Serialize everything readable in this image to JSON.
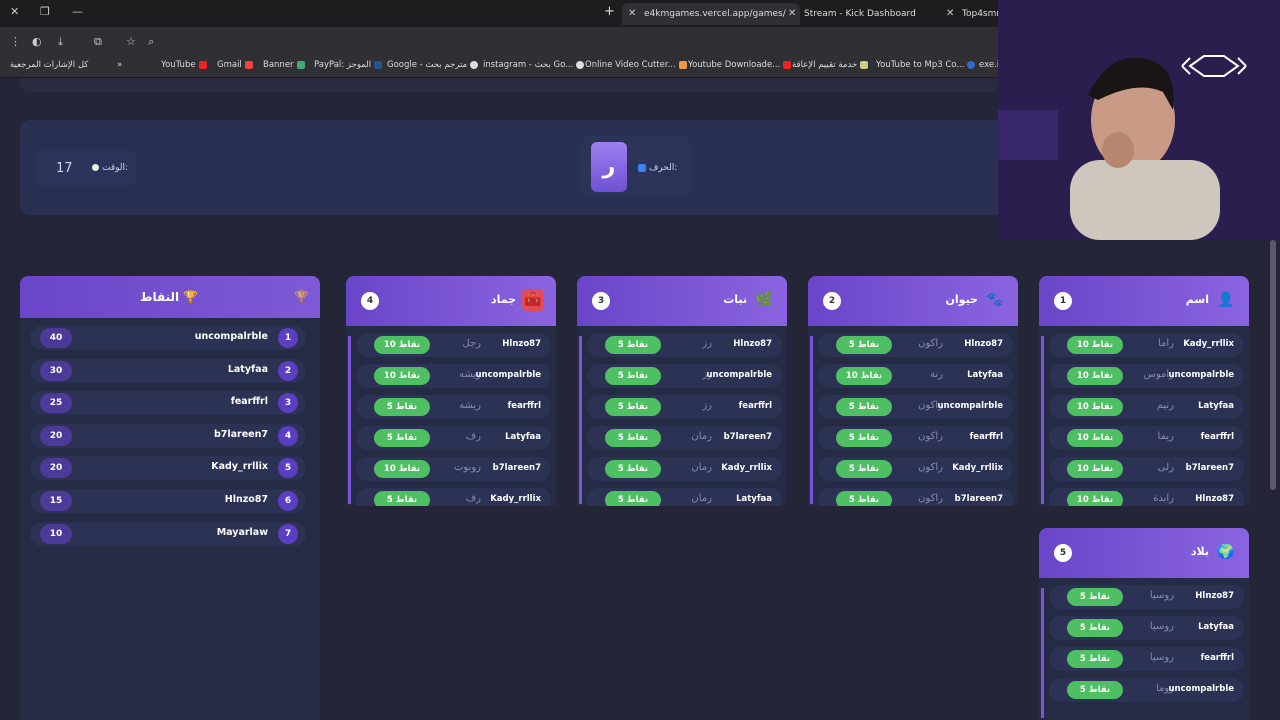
{
  "browser": {
    "tabs": [
      {
        "title": "e4kmgames.vercel.app/games/",
        "active": true
      },
      {
        "title": "Stream - Kick Dashboard",
        "active": false
      },
      {
        "title": "Top4smm",
        "active": false
      }
    ],
    "bookmarks": [
      "كل الإشارات المرجعية",
      "YouTube",
      "Gmail",
      "Banner",
      "PayPal: الموجز",
      "Google - مترجم بحث",
      "instagram - بحث Go...",
      "Online Video Cutter...",
      "Youtube Downloade...",
      "خدمة تقييم الإعاقة",
      "YouTube to Mp3 Co...",
      "exe.io"
    ]
  },
  "game": {
    "timer_label": "الوقت:",
    "timer_value": "17",
    "letter_label": "الحرف:",
    "letter": "ر",
    "scores_title": "النقاط",
    "scores": [
      {
        "rank": "1",
        "name": "uncompalrble",
        "points": "40"
      },
      {
        "rank": "2",
        "name": "Latyfaa",
        "points": "30"
      },
      {
        "rank": "3",
        "name": "fearffrl",
        "points": "25"
      },
      {
        "rank": "4",
        "name": "b7lareen7",
        "points": "20"
      },
      {
        "rank": "5",
        "name": "Kady_rrllix",
        "points": "20"
      },
      {
        "rank": "6",
        "name": "Hlnzo87",
        "points": "15"
      },
      {
        "rank": "7",
        "name": "Mayarlaw",
        "points": "10"
      }
    ],
    "categories": [
      {
        "key": "jamad",
        "name": "جماد",
        "num": "4",
        "icon": "toolbox-icon",
        "rows": [
          {
            "player": "Hlnzo87",
            "answer": "رجل",
            "points": "10 نقاط"
          },
          {
            "player": "uncompalrble",
            "answer": "ريشه",
            "points": "10 نقاط"
          },
          {
            "player": "fearffrl",
            "answer": "ريشه",
            "points": "5 نقاط"
          },
          {
            "player": "Latyfaa",
            "answer": "رف",
            "points": "5 نقاط"
          },
          {
            "player": "b7lareen7",
            "answer": "روبوت",
            "points": "10 نقاط"
          },
          {
            "player": "Kady_rrllix",
            "answer": "رف",
            "points": "5 نقاط"
          }
        ]
      },
      {
        "key": "nabat",
        "name": "نبات",
        "num": "3",
        "icon": "leaf-icon",
        "rows": [
          {
            "player": "Hlnzo87",
            "answer": "رز",
            "points": "5 نقاط"
          },
          {
            "player": "uncompalrble",
            "answer": "رز",
            "points": "5 نقاط"
          },
          {
            "player": "fearffrl",
            "answer": "رز",
            "points": "5 نقاط"
          },
          {
            "player": "b7lareen7",
            "answer": "رمان",
            "points": "5 نقاط"
          },
          {
            "player": "Kady_rrllix",
            "answer": "رمان",
            "points": "5 نقاط"
          },
          {
            "player": "Latyfaa",
            "answer": "رمان",
            "points": "5 نقاط"
          }
        ]
      },
      {
        "key": "hayawan",
        "name": "حيوان",
        "num": "2",
        "icon": "paw-icon",
        "rows": [
          {
            "player": "Hlnzo87",
            "answer": "راكون",
            "points": "5 نقاط"
          },
          {
            "player": "Latyfaa",
            "answer": "رنة",
            "points": "10 نقاط"
          },
          {
            "player": "uncompalrble",
            "answer": "راكون",
            "points": "5 نقاط"
          },
          {
            "player": "fearffrl",
            "answer": "راكون",
            "points": "5 نقاط"
          },
          {
            "player": "Kady_rrllix",
            "answer": "راكون",
            "points": "5 نقاط"
          },
          {
            "player": "b7lareen7",
            "answer": "راكون",
            "points": "5 نقاط"
          }
        ]
      },
      {
        "key": "ism",
        "name": "اسم",
        "num": "1",
        "icon": "person-icon",
        "rows": [
          {
            "player": "Kady_rrllix",
            "answer": "راما",
            "points": "10 نقاط"
          },
          {
            "player": "uncompalrble",
            "answer": "راموس",
            "points": "10 نقاط"
          },
          {
            "player": "Latyfaa",
            "answer": "رنيم",
            "points": "10 نقاط"
          },
          {
            "player": "fearffrl",
            "answer": "ريما",
            "points": "10 نقاط"
          },
          {
            "player": "b7lareen7",
            "answer": "رلى",
            "points": "10 نقاط"
          },
          {
            "player": "Hlnzo87",
            "answer": "رابدة",
            "points": "10 نقاط"
          }
        ]
      },
      {
        "key": "bilad",
        "name": "بلاد",
        "num": "5",
        "icon": "globe-icon",
        "rows": [
          {
            "player": "Hlnzo87",
            "answer": "روسيا",
            "points": "5 نقاط"
          },
          {
            "player": "Latyfaa",
            "answer": "روسيا",
            "points": "5 نقاط"
          },
          {
            "player": "fearffrl",
            "answer": "روسيا",
            "points": "5 نقاط"
          },
          {
            "player": "uncompalrble",
            "answer": "روما",
            "points": "5 نقاط"
          }
        ]
      }
    ]
  }
}
